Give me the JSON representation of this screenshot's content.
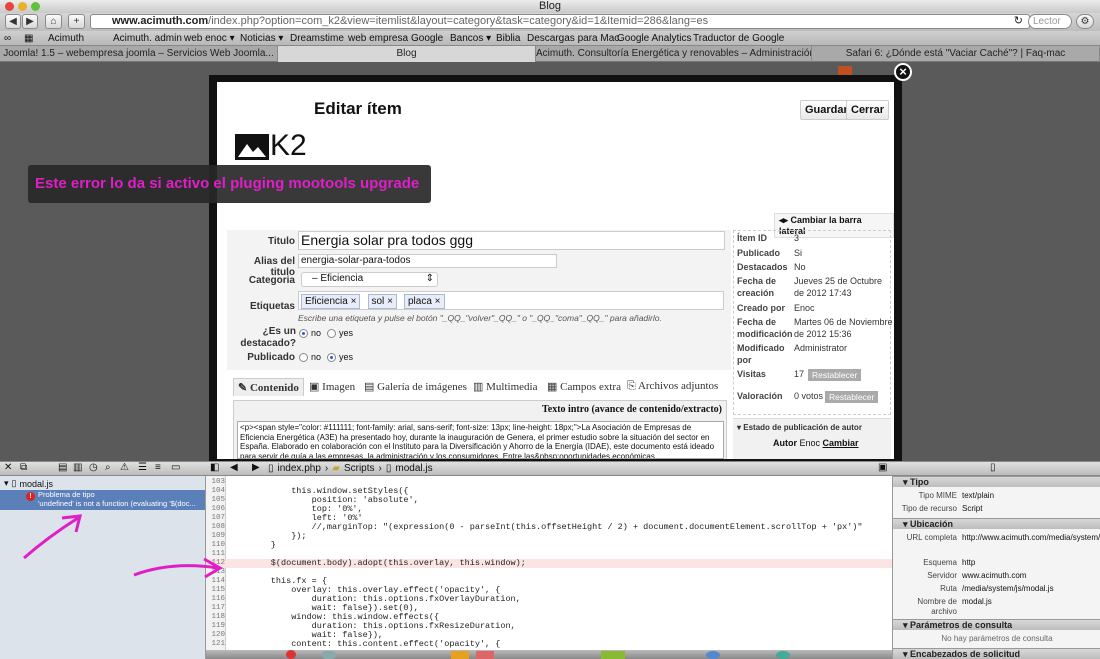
{
  "browser": {
    "window_title": "Blog",
    "url_host": "www.acimuth.com",
    "url_rest": "/index.php?option=com_k2&view=itemlist&layout=category&task=category&id=1&Itemid=286&lang=es",
    "search_placeholder": "Lector",
    "bookmarks": [
      "Acimuth",
      "Acimuth. admin",
      "web enoc ▾",
      "Noticias ▾",
      "Dreamstime",
      "web empresa",
      "Google",
      "Bancos ▾",
      "Biblia",
      "Descargas para Mac",
      "Google Analytics",
      "Traductor de Google"
    ],
    "tabs": [
      {
        "label": "Joomla! 1.5 – webempresa joomla – Servicios Web Joomla...",
        "active": false
      },
      {
        "label": "Blog",
        "active": true
      },
      {
        "label": "Acimuth. Consultoría Energética y renovables – Administración",
        "active": false
      },
      {
        "label": "Safari 6: ¿Dónde está \"Vaciar Caché\"? | Faq-mac",
        "active": false
      }
    ]
  },
  "modal": {
    "title": "Editar ítem",
    "logo_text": "K2",
    "save_label": "Guardar",
    "close_label": "Cerrar",
    "toggle_sidebar": "Cambiar la barra lateral",
    "labels": {
      "titulo": "Titulo",
      "alias": "Alias del titulo",
      "categoria": "Categoria",
      "etiquetas": "Etiquetas",
      "destacado": "¿Es un destacado?",
      "publicado": "Publicado"
    },
    "values": {
      "titulo": "Energia solar pra todos ggg",
      "alias": "energia-solar-para-todos",
      "categoria": "– Eficiencia"
    },
    "tags": [
      "Eficiencia",
      "sol",
      "placa"
    ],
    "tag_hint": "Escribe una etiqueta y pulse el botón \"_QQ_\"volver\"_QQ_\" o \"_QQ_\"coma\"_QQ_\" para añadirlo.",
    "no_label": "no",
    "yes_label": "yes",
    "destacado_value": "no",
    "publicado_value": "yes",
    "meta": [
      {
        "k": "Ítem ID",
        "v": "3"
      },
      {
        "k": "Publicado",
        "v": "Si"
      },
      {
        "k": "Destacados",
        "v": "No"
      },
      {
        "k": "Fecha de creación",
        "v": "Jueves 25 de Octubre de 2012 17:43"
      },
      {
        "k": "Creado por",
        "v": "Enoc"
      },
      {
        "k": "Fecha de modificación",
        "v": "Martes 06 de Noviembre de 2012 15:36"
      },
      {
        "k": "Modificado por",
        "v": "Administrator"
      },
      {
        "k": "Visitas",
        "v": "17"
      },
      {
        "k": "Valoración",
        "v": "0 votos"
      }
    ],
    "reset_label": "Restablecer",
    "author_state": "Estado de publicación de autor",
    "author_label": "Autor",
    "author_value": "Enoc",
    "change_label": "Cambiar",
    "tabs": [
      "Contenido",
      "Imagen",
      "Galería de imágenes",
      "Multimedia",
      "Campos extra",
      "Archivos adjuntos"
    ],
    "intro_label": "Texto intro (avance de contenido/extracto)",
    "editor_text": "<p><span style=\"color: #111111; font-family: arial, sans-serif; font-size: 13px; line-height: 18px;\">La Asociación de Empresas de Eficiencia Energética (A3E) ha presentado hoy, durante la inauguración de Genera, el primer estudio sobre la situación del sector en España. Elaborado en colaboración con el Instituto para la Diversificación y Ahorro de la Energía (IDAE), este documento está ideado para servir de guía a las empresas, la administración y los consumidores. Entre las&nbsp;oportunidades económicas"
  },
  "annotation": "Este error lo da si activo el pluging mootools upgrade",
  "inspector": {
    "breadcrumb": [
      "index.php",
      "Scripts",
      "modal.js"
    ],
    "file": "modal.js",
    "error_title": "Problema de tipo",
    "error_detail": "'undefined' is not a function (evaluating '$(doc...",
    "code_lines": [
      {
        "n": "103",
        "t": ""
      },
      {
        "n": "104",
        "t": "            this.window.setStyles({"
      },
      {
        "n": "105",
        "t": "                position: 'absolute',"
      },
      {
        "n": "106",
        "t": "                top: '0%',"
      },
      {
        "n": "107",
        "t": "                left: '0%'"
      },
      {
        "n": "108",
        "t": "                //,marginTop: \"(expression(0 - parseInt(this.offsetHeight / 2) + document.documentElement.scrollTop + 'px')\""
      },
      {
        "n": "109",
        "t": "            });"
      },
      {
        "n": "110",
        "t": "        }"
      },
      {
        "n": "111",
        "t": ""
      },
      {
        "n": "112",
        "t": "        $(document.body).adopt(this.overlay, this.window);"
      },
      {
        "n": "113",
        "t": ""
      },
      {
        "n": "114",
        "t": "        this.fx = {"
      },
      {
        "n": "115",
        "t": "            overlay: this.overlay.effect('opacity', {"
      },
      {
        "n": "116",
        "t": "                duration: this.options.fxOverlayDuration,"
      },
      {
        "n": "117",
        "t": "                wait: false}).set(0),"
      },
      {
        "n": "118",
        "t": "            window: this.window.effects({"
      },
      {
        "n": "119",
        "t": "                duration: this.options.fxResizeDuration,"
      },
      {
        "n": "120",
        "t": "                wait: false}),"
      },
      {
        "n": "121",
        "t": "            content: this.content.effect('opacity', {"
      }
    ],
    "sections": {
      "tipo": "Tipo",
      "ubicacion": "Ubicación",
      "params": "Parámetros de consulta",
      "headers": "Encabezados de solicitud"
    },
    "tipo": [
      {
        "k": "Tipo MIME",
        "v": "text/plain"
      },
      {
        "k": "Tipo de recurso",
        "v": "Script"
      }
    ],
    "ubicacion": [
      {
        "k": "URL completa",
        "v": "http://www.acimuth.com/media/system/js/modal.js"
      },
      {
        "k": "Esquema",
        "v": "http"
      },
      {
        "k": "Servidor",
        "v": "www.acimuth.com"
      },
      {
        "k": "Ruta",
        "v": "/media/system/js/modal.js"
      },
      {
        "k": "Nombre de archivo",
        "v": "modal.js"
      }
    ],
    "no_params": "No hay parámetros de consulta"
  },
  "colors": {
    "accent": "#e01ec8",
    "error_row": "#5b7fb8",
    "highlight_line": "#fbe4e4"
  }
}
